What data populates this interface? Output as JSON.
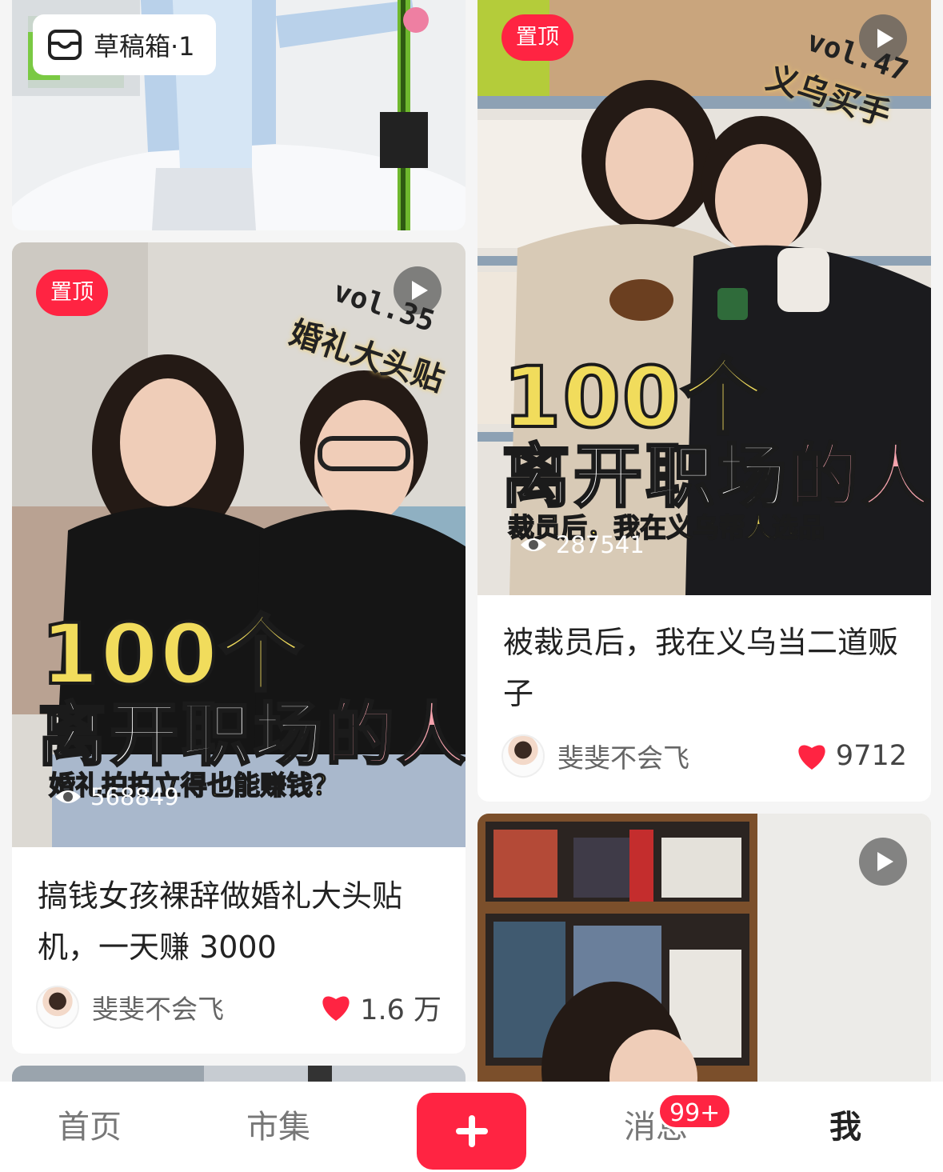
{
  "draft": {
    "label": "草稿箱·1"
  },
  "cards": [
    {
      "pin_label": "置顶",
      "cover": {
        "vol": "vol.35",
        "series": "婚礼大头贴",
        "number": "100个",
        "headline_main": "离开职场",
        "headline_accent": "的人",
        "subline": "婚礼拍拍立得也能赚钱？"
      },
      "views": "568849",
      "title": "搞钱女孩裸辞做婚礼大头贴机，一天赚 3000",
      "author": "斐斐不会飞",
      "likes": "1.6 万"
    },
    {
      "pin_label": "置顶",
      "cover": {
        "vol": "vol.47",
        "series": "义乌买手",
        "number": "100个",
        "headline_main": "离开职场",
        "headline_accent": "的人",
        "subline": "裁员后，我在义乌帮人选品"
      },
      "views": "287541",
      "title": "被裁员后，我在义乌当二道贩子",
      "author": "斐斐不会飞",
      "likes": "9712"
    }
  ],
  "tabbar": {
    "home": "首页",
    "market": "市集",
    "messages": "消息",
    "messages_badge": "99+",
    "me": "我"
  },
  "colors": {
    "accent": "#ff2442",
    "title_yellow": "#f1dc5c",
    "title_pink": "#f6a3ad"
  }
}
